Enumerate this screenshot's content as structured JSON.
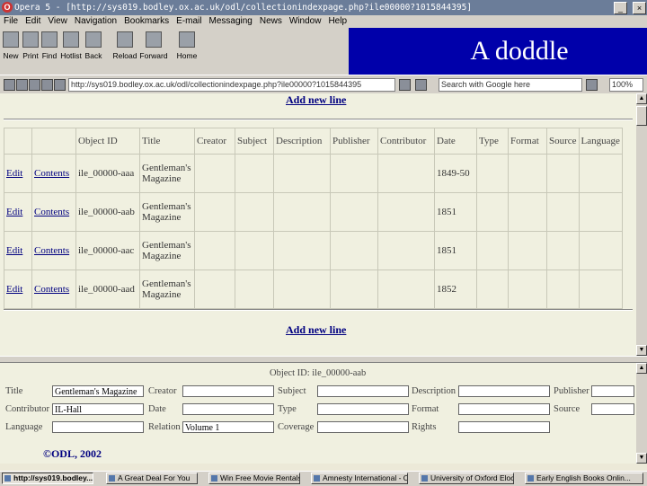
{
  "window": {
    "title": "Opera 5 - [http://sys019.bodley.ox.ac.uk/odl/collectionindexpage.php?ile00000?1015844395]",
    "minimize": "_",
    "restore": "□",
    "close": "×"
  },
  "menu": [
    "File",
    "Edit",
    "View",
    "Navigation",
    "Bookmarks",
    "E-mail",
    "Messaging",
    "News",
    "Window",
    "Help"
  ],
  "toolbar": {
    "buttons": [
      {
        "label": "New",
        "icon": "new-page-icon"
      },
      {
        "label": "Print",
        "icon": "print-icon"
      },
      {
        "label": "Find",
        "icon": "find-icon"
      },
      {
        "label": "Hotlist",
        "icon": "hotlist-icon"
      },
      {
        "label": "Back",
        "icon": "back-arrow-icon"
      },
      {
        "label": "Reload",
        "icon": "reload-icon"
      },
      {
        "label": "Forward",
        "icon": "forward-arrow-icon"
      },
      {
        "label": "Home",
        "icon": "home-icon"
      }
    ]
  },
  "banner": {
    "text": "A doddle"
  },
  "address": {
    "url": "http://sys019.bodley.ox.ac.uk/odl/collectionindexpage.php?ile00000?1015844395",
    "search_engine": "Search with Google here",
    "zoom": "100%"
  },
  "page": {
    "add_new_line": "Add new line",
    "columns": [
      "",
      "",
      "Object ID",
      "Title",
      "Creator",
      "Subject",
      "Description",
      "Publisher",
      "Contributor",
      "Date",
      "Type",
      "Format",
      "Source",
      "Language"
    ],
    "edit_label": "Edit",
    "contents_label": "Contents",
    "rows": [
      {
        "object_id": "ile_00000-aaa",
        "title": "Gentleman's Magazine",
        "date": "1849-50"
      },
      {
        "object_id": "ile_00000-aab",
        "title": "Gentleman's Magazine",
        "date": "1851"
      },
      {
        "object_id": "ile_00000-aac",
        "title": "Gentleman's Magazine",
        "date": "1851"
      },
      {
        "object_id": "ile_00000-aad",
        "title": "Gentleman's Magazine",
        "date": "1852"
      }
    ]
  },
  "form": {
    "object_id_label": "Object ID: ile_00000-aab",
    "fields": {
      "title": {
        "label": "Title",
        "value": "Gentleman's Magazine"
      },
      "creator": {
        "label": "Creator",
        "value": ""
      },
      "subject": {
        "label": "Subject",
        "value": ""
      },
      "description": {
        "label": "Description",
        "value": ""
      },
      "publisher": {
        "label": "Publisher",
        "value": ""
      },
      "contributor": {
        "label": "Contributor",
        "value": "IL-Hall"
      },
      "date": {
        "label": "Date",
        "value": ""
      },
      "type": {
        "label": "Type",
        "value": ""
      },
      "format": {
        "label": "Format",
        "value": ""
      },
      "source": {
        "label": "Source",
        "value": ""
      },
      "language": {
        "label": "Language",
        "value": ""
      },
      "relation": {
        "label": "Relation",
        "value": "Volume 1"
      },
      "coverage": {
        "label": "Coverage",
        "value": ""
      },
      "rights": {
        "label": "Rights",
        "value": ""
      }
    },
    "copyright": "©ODL, 2002"
  },
  "taskbar": [
    {
      "label": "http://sys019.bodley...",
      "active": true
    },
    {
      "label": "A Great Deal For You",
      "active": false
    },
    {
      "label": "Win Free Movie Rentals!",
      "active": false
    },
    {
      "label": "Amnesty International - O...",
      "active": false
    },
    {
      "label": "University of Oxford Eloc...",
      "active": false
    },
    {
      "label": "Early English Books Onlin...",
      "active": false
    }
  ],
  "colors": {
    "banner": "#0000aa",
    "link": "#000080",
    "page_bg": "#f0f0e0",
    "chrome": "#d4d0c8"
  }
}
